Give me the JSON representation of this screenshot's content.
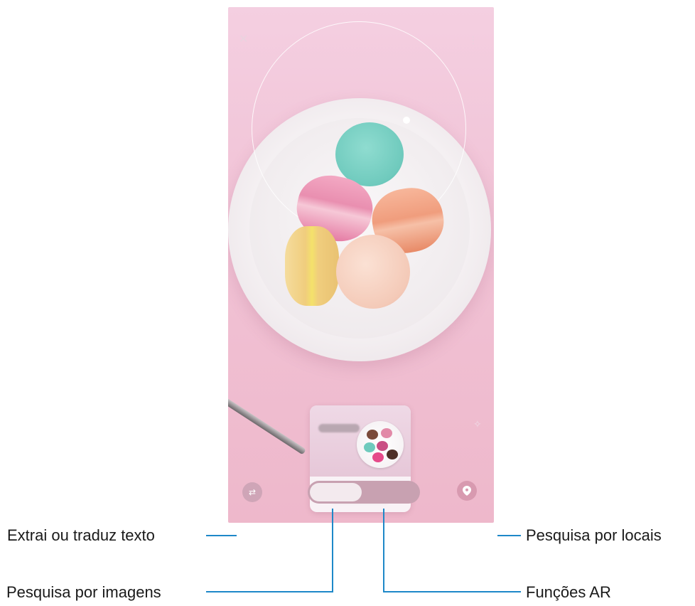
{
  "screen": {
    "top_bar": {
      "close_icon": "close-icon",
      "more_icon": "more-options-icon"
    },
    "result_card": {
      "title": "",
      "subtitle": ""
    },
    "bottom_bar": {
      "text_extract_icon": "text-extract-icon",
      "places_icon": "location-pin-icon",
      "modes": [
        {
          "label": "",
          "selected": true
        },
        {
          "label": "",
          "selected": false
        }
      ]
    }
  },
  "callouts": {
    "extract_text": "Extrai ou traduz texto",
    "search_places": "Pesquisa por locais",
    "search_images": "Pesquisa por imagens",
    "ar_functions": "Funções AR"
  },
  "colors": {
    "callout_line": "#1e88c8",
    "screen_background": "#f1c3d6"
  }
}
